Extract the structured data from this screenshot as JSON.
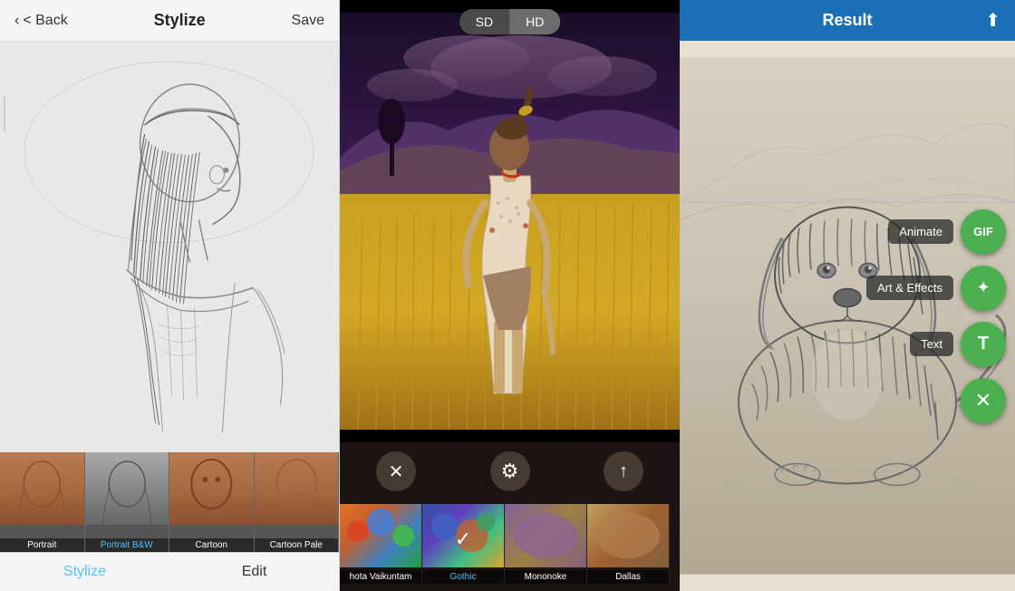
{
  "panel1": {
    "header": {
      "back_label": "< Back",
      "title": "Stylize",
      "save_label": "Save"
    },
    "thumbnails": [
      {
        "id": "portrait",
        "label": "Portrait",
        "active": false,
        "bg": "face-portrait"
      },
      {
        "id": "portrait-bw",
        "label": "Portrait B&W",
        "active": true,
        "bg": "face-portrait-bw"
      },
      {
        "id": "cartoon",
        "label": "Cartoon",
        "active": false,
        "bg": "face-cartoon"
      },
      {
        "id": "cartoon-pale",
        "label": "Cartoon Pale",
        "active": false,
        "bg": "face-cartoon-pale"
      }
    ],
    "tabs": [
      {
        "id": "stylize",
        "label": "Stylize",
        "active": true
      },
      {
        "id": "edit",
        "label": "Edit",
        "active": false
      }
    ]
  },
  "panel2": {
    "quality_buttons": [
      {
        "id": "sd",
        "label": "SD",
        "active": true
      },
      {
        "id": "hd",
        "label": "HD",
        "active": false
      }
    ],
    "controls": [
      {
        "id": "close",
        "icon": "✕"
      },
      {
        "id": "adjust",
        "icon": "⚙"
      },
      {
        "id": "share",
        "icon": "↑"
      }
    ],
    "filters": [
      {
        "id": "vaikuntam",
        "label": "hota Vaikuntam",
        "bg": "f-vaikuntam",
        "active": false
      },
      {
        "id": "gothic",
        "label": "Gothic",
        "bg": "f-gothic",
        "active": true
      },
      {
        "id": "mononoke",
        "label": "Mononoke",
        "bg": "f-mononoke",
        "active": false
      },
      {
        "id": "dallas",
        "label": "Dallas",
        "bg": "f-dallas",
        "active": false
      }
    ]
  },
  "panel3": {
    "header": {
      "title": "Result",
      "share_icon": "⬆"
    },
    "side_buttons": [
      {
        "id": "animate",
        "label": "Animate",
        "icon": "GIF"
      },
      {
        "id": "art-effects",
        "label": "Art & Effects",
        "icon": "✦"
      },
      {
        "id": "text",
        "label": "Text",
        "icon": "T"
      },
      {
        "id": "close",
        "label": "",
        "icon": "✕"
      }
    ]
  }
}
